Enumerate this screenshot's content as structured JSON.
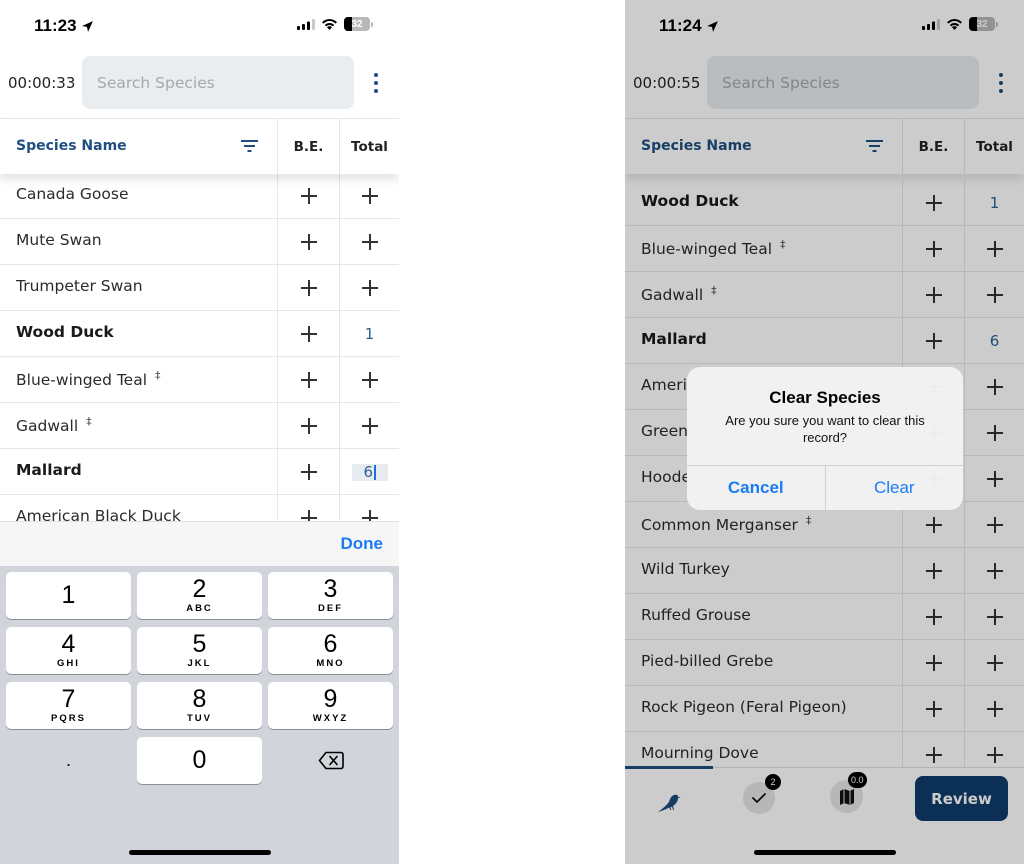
{
  "left": {
    "status": {
      "time": "11:23",
      "battery": "32"
    },
    "timer": "00:00:33",
    "search_placeholder": "Search Species",
    "table_header": {
      "name": "Species Name",
      "be": "B.E.",
      "total": "Total"
    },
    "rows": [
      {
        "name": "Canada Goose",
        "bold": false,
        "dagger": "",
        "total": ""
      },
      {
        "name": "Mute Swan",
        "bold": false,
        "dagger": "",
        "total": ""
      },
      {
        "name": "Trumpeter Swan",
        "bold": false,
        "dagger": "",
        "total": ""
      },
      {
        "name": "Wood Duck",
        "bold": true,
        "dagger": "",
        "total": "1"
      },
      {
        "name": "Blue-winged Teal",
        "bold": false,
        "dagger": "‡",
        "total": ""
      },
      {
        "name": "Gadwall",
        "bold": false,
        "dagger": "‡",
        "total": ""
      },
      {
        "name": "Mallard",
        "bold": true,
        "dagger": "",
        "total": "6",
        "editing": true
      },
      {
        "name": "American Black Duck",
        "bold": false,
        "dagger": "",
        "total": ""
      }
    ],
    "keyboard": {
      "done_label": "Done",
      "keys": [
        {
          "digit": "1",
          "letters": ""
        },
        {
          "digit": "2",
          "letters": "ABC"
        },
        {
          "digit": "3",
          "letters": "DEF"
        },
        {
          "digit": "4",
          "letters": "GHI"
        },
        {
          "digit": "5",
          "letters": "JKL"
        },
        {
          "digit": "6",
          "letters": "MNO"
        },
        {
          "digit": "7",
          "letters": "PQRS"
        },
        {
          "digit": "8",
          "letters": "TUV"
        },
        {
          "digit": "9",
          "letters": "WXYZ"
        },
        {
          "digit": ".",
          "letters": ""
        },
        {
          "digit": "0",
          "letters": ""
        }
      ]
    }
  },
  "right": {
    "status": {
      "time": "11:24",
      "battery": "32"
    },
    "timer": "00:00:55",
    "search_placeholder": "Search Species",
    "table_header": {
      "name": "Species Name",
      "be": "B.E.",
      "total": "Total"
    },
    "rows": [
      {
        "name": "Wood Duck",
        "bold": true,
        "dagger": "",
        "total": "1"
      },
      {
        "name": "Blue-winged Teal",
        "bold": false,
        "dagger": "‡",
        "total": ""
      },
      {
        "name": "Gadwall",
        "bold": false,
        "dagger": "‡",
        "total": ""
      },
      {
        "name": "Mallard",
        "bold": true,
        "dagger": "",
        "total": "6"
      },
      {
        "name": "Ameri",
        "bold": false,
        "dagger": "",
        "total": ""
      },
      {
        "name": "Green",
        "bold": false,
        "dagger": "",
        "total": ""
      },
      {
        "name": "Hoode",
        "bold": false,
        "dagger": "",
        "total": ""
      },
      {
        "name": "Common Merganser",
        "bold": false,
        "dagger": "‡",
        "total": ""
      },
      {
        "name": "Wild Turkey",
        "bold": false,
        "dagger": "",
        "total": ""
      },
      {
        "name": "Ruffed Grouse",
        "bold": false,
        "dagger": "",
        "total": ""
      },
      {
        "name": "Pied-billed Grebe",
        "bold": false,
        "dagger": "",
        "total": ""
      },
      {
        "name": "Rock Pigeon (Feral Pigeon)",
        "bold": false,
        "dagger": "",
        "total": ""
      },
      {
        "name": "Mourning Dove",
        "bold": false,
        "dagger": "",
        "total": ""
      }
    ],
    "alert": {
      "title": "Clear Species",
      "message": "Are you sure you want to clear this record?",
      "cancel_label": "Cancel",
      "confirm_label": "Clear"
    },
    "bottom_nav": {
      "checklist_badge": "2",
      "map_badge": "0.0",
      "review_label": "Review"
    }
  },
  "colors": {
    "brand": "#1c4d7e",
    "ios_blue": "#1a7cf5",
    "review_button": "#0f3d6b"
  }
}
